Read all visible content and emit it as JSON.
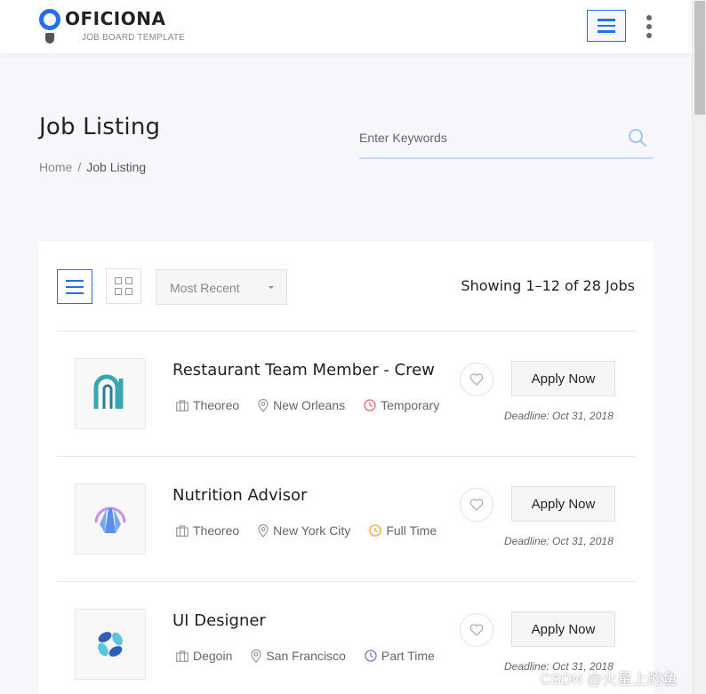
{
  "header": {
    "brand_name": "OFICIONA",
    "brand_tagline": "JOB BOARD TEMPLATE"
  },
  "page": {
    "title": "Job Listing",
    "breadcrumb": [
      "Home",
      "/",
      "Job Listing"
    ]
  },
  "search": {
    "placeholder": "Enter Keywords"
  },
  "toolbar": {
    "sort_value": "Most Recent",
    "showing_text": "Showing 1–12 of 28 Jobs"
  },
  "jobs": [
    {
      "title": "Restaurant Team Member - Crew",
      "company": "Theoreo",
      "location": "New Orleans",
      "type": "Temporary",
      "type_color": "#f06574",
      "apply_label": "Apply Now",
      "deadline": "Deadline: Oct 31, 2018",
      "logo_icon": "teal-arch-logo"
    },
    {
      "title": "Nutrition Advisor",
      "company": "Theoreo",
      "location": "New York City",
      "type": "Full Time",
      "type_color": "#f5a623",
      "apply_label": "Apply Now",
      "deadline": "Deadline: Oct 31, 2018",
      "logo_icon": "purple-dome-logo"
    },
    {
      "title": "UI Designer",
      "company": "Degoin",
      "location": "San Francisco",
      "type": "Part Time",
      "type_color": "#7b6fd6",
      "apply_label": "Apply Now",
      "deadline": "Deadline: Oct 31, 2018",
      "logo_icon": "blue-swirl-logo"
    }
  ],
  "colors": {
    "accent": "#246df8",
    "background": "#f6f7fb"
  },
  "watermark": "CSDN @火星上的鱼"
}
